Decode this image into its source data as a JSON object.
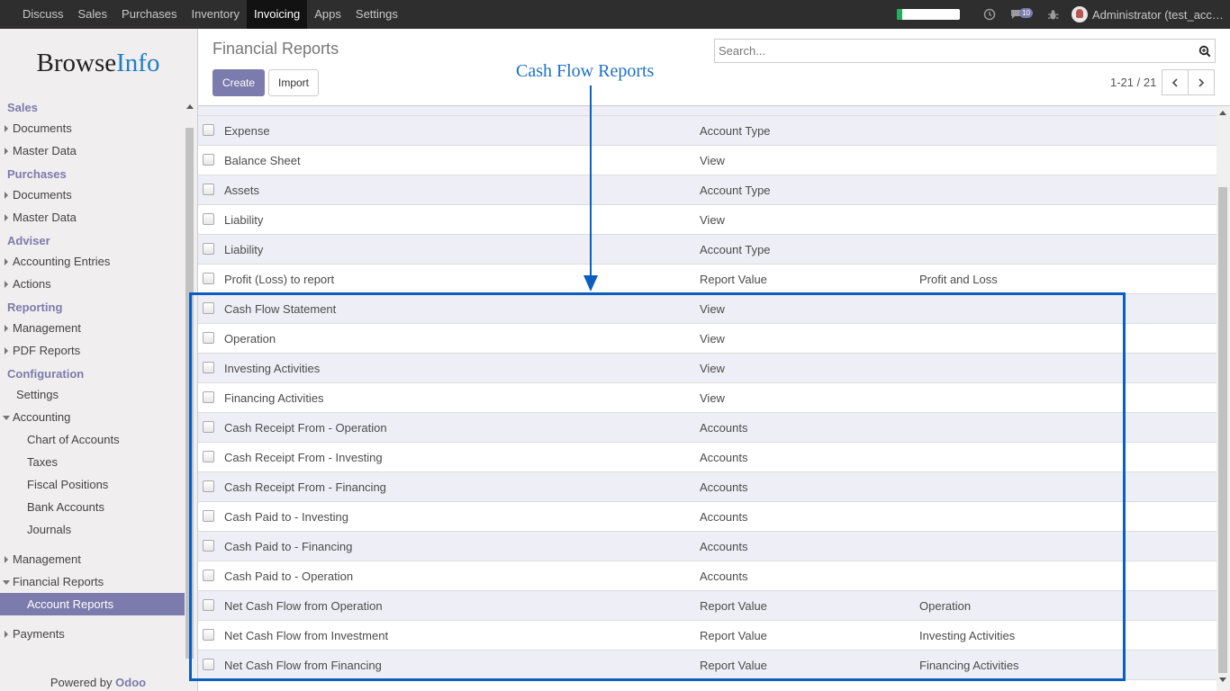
{
  "topbar": {
    "menu": [
      {
        "label": "Discuss",
        "active": false
      },
      {
        "label": "Sales",
        "active": false
      },
      {
        "label": "Purchases",
        "active": false
      },
      {
        "label": "Inventory",
        "active": false
      },
      {
        "label": "Invoicing",
        "active": true
      },
      {
        "label": "Apps",
        "active": false
      },
      {
        "label": "Settings",
        "active": false
      }
    ],
    "progress_fraction": 0.08,
    "messages_count": "10",
    "user_label": "Administrator (test_acc…"
  },
  "sidebar": {
    "logo_browse": "Browse",
    "logo_info": "Info",
    "sections": [
      {
        "head": "Sales",
        "items": [
          {
            "label": "Documents",
            "kind": "collapsed"
          },
          {
            "label": "Master Data",
            "kind": "collapsed"
          }
        ]
      },
      {
        "head": "Purchases",
        "items": [
          {
            "label": "Documents",
            "kind": "collapsed"
          },
          {
            "label": "Master Data",
            "kind": "collapsed"
          }
        ]
      },
      {
        "head": "Adviser",
        "items": [
          {
            "label": "Accounting Entries",
            "kind": "collapsed"
          },
          {
            "label": "Actions",
            "kind": "collapsed"
          }
        ]
      },
      {
        "head": "Reporting",
        "items": [
          {
            "label": "Management",
            "kind": "collapsed"
          },
          {
            "label": "PDF Reports",
            "kind": "collapsed"
          }
        ]
      },
      {
        "head": "Configuration",
        "items": [
          {
            "label": "Settings",
            "kind": "plain"
          },
          {
            "label": "Accounting",
            "kind": "expanded"
          },
          {
            "label": "Chart of Accounts",
            "kind": "sub"
          },
          {
            "label": "Taxes",
            "kind": "sub"
          },
          {
            "label": "Fiscal Positions",
            "kind": "sub"
          },
          {
            "label": "Bank Accounts",
            "kind": "sub"
          },
          {
            "label": "Journals",
            "kind": "sub"
          },
          {
            "label": "",
            "kind": "spacer"
          },
          {
            "label": "Management",
            "kind": "collapsed"
          },
          {
            "label": "Financial Reports",
            "kind": "expanded"
          },
          {
            "label": "Account Reports",
            "kind": "sub-active"
          },
          {
            "label": "",
            "kind": "spacer"
          },
          {
            "label": "Payments",
            "kind": "collapsed"
          }
        ]
      }
    ],
    "powered_by": "Powered by ",
    "powered_brand": "Odoo"
  },
  "control_panel": {
    "title": "Financial Reports",
    "create_label": "Create",
    "import_label": "Import",
    "search_placeholder": "Search...",
    "pager": "1-21 / 21"
  },
  "annotation": {
    "label": "Cash Flow Reports"
  },
  "list": {
    "rows": [
      {
        "name": "Expense",
        "type": "Account Type",
        "parent": ""
      },
      {
        "name": "Balance Sheet",
        "type": "View",
        "parent": ""
      },
      {
        "name": "Assets",
        "type": "Account Type",
        "parent": ""
      },
      {
        "name": "Liability",
        "type": "View",
        "parent": ""
      },
      {
        "name": "Liability",
        "type": "Account Type",
        "parent": ""
      },
      {
        "name": "Profit (Loss) to report",
        "type": "Report Value",
        "parent": "Profit and Loss"
      },
      {
        "name": "Cash Flow Statement",
        "type": "View",
        "parent": ""
      },
      {
        "name": "Operation",
        "type": "View",
        "parent": ""
      },
      {
        "name": "Investing Activities",
        "type": "View",
        "parent": ""
      },
      {
        "name": "Financing Activities",
        "type": "View",
        "parent": ""
      },
      {
        "name": "Cash Receipt From - Operation",
        "type": "Accounts",
        "parent": ""
      },
      {
        "name": "Cash Receipt From - Investing",
        "type": "Accounts",
        "parent": ""
      },
      {
        "name": "Cash Receipt From - Financing",
        "type": "Accounts",
        "parent": ""
      },
      {
        "name": "Cash Paid to - Investing",
        "type": "Accounts",
        "parent": ""
      },
      {
        "name": "Cash Paid to - Financing",
        "type": "Accounts",
        "parent": ""
      },
      {
        "name": "Cash Paid to - Operation",
        "type": "Accounts",
        "parent": ""
      },
      {
        "name": "Net Cash Flow from Operation",
        "type": "Report Value",
        "parent": "Operation"
      },
      {
        "name": "Net Cash Flow from Investment",
        "type": "Report Value",
        "parent": "Investing Activities"
      },
      {
        "name": "Net Cash Flow from Financing",
        "type": "Report Value",
        "parent": "Financing Activities"
      }
    ]
  }
}
